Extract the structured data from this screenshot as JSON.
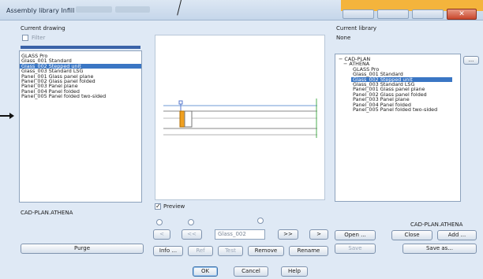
{
  "window": {
    "title": "Assembly library Infill",
    "close_glyph": "✕"
  },
  "left": {
    "heading": "Current drawing",
    "filter_label": "Filter",
    "items": [
      "GLASS Pro",
      "Glass_001  Standard",
      "Glass_002  Stepped unit",
      "Glass_003  Standard LSG",
      "Panel_001  Glass panel plane",
      "Panel_002  Glass panel folded",
      "Panel_003  Panel plane",
      "Panel_004  Panel folded",
      "Panel_005  Panel folded two-sided"
    ],
    "selected_index": 2,
    "footer_label": "CAD-PLAN.ATHENA",
    "purge_button": "Purge"
  },
  "center": {
    "preview_label": "Preview",
    "preview_checked": true,
    "nav": {
      "first": "<",
      "prev": "<<",
      "current": "Glass_002",
      "next": ">>",
      "last": ">"
    },
    "actions": {
      "info": "Info ...",
      "ref": "Ref",
      "test": "Test",
      "remove": "Remove",
      "rename": "Rename"
    }
  },
  "right": {
    "heading": "Current library",
    "library_value": "None",
    "browse_button": "...",
    "tree": [
      "CAD-PLAN",
      "ATHENA",
      "GLASS Pro",
      "Glass_001  Standard",
      "Glass_002  Stepped unit",
      "Glass_003  Standard LSG",
      "Panel_001 Glass panel plane",
      "Panel_002 Glass panel folded",
      "Panel_003 Panel plane",
      "Panel_004 Panel folded",
      "Panel_005 Panel folded two-sided"
    ],
    "tree_toggle_glyphs": [
      "−",
      "−"
    ],
    "selected_index": 4,
    "footer_label": "CAD-PLAN.ATHENA",
    "buttons": {
      "open": "Open ...",
      "close": "Close",
      "add": "Add ...",
      "save": "Save",
      "save_as": "Save as..."
    }
  },
  "footer": {
    "ok": "OK",
    "cancel": "Cancel",
    "help": "Help"
  },
  "colors": {
    "selection": "#3a76c4",
    "client_bg": "#dfe9f5",
    "accent_orange": "#f4b43c"
  }
}
